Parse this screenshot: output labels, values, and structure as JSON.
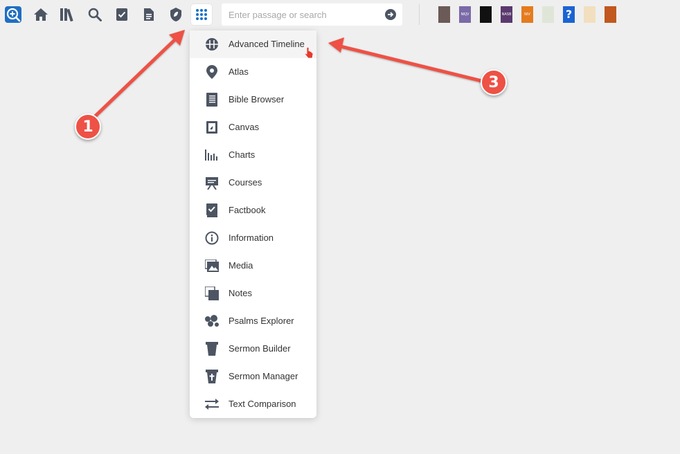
{
  "toolbar": {
    "icons": [
      "logos-app-icon",
      "home-icon",
      "library-icon",
      "search-icon",
      "documents-checklist-icon",
      "document-icon",
      "shield-leaf-icon",
      "apps-grid-icon"
    ],
    "search_placeholder": "Enter passage or search",
    "search_value": "",
    "book_covers": [
      {
        "color": "#6b5a57",
        "label": ""
      },
      {
        "color": "#7a6aa8",
        "label": "NKJV"
      },
      {
        "color": "#111111",
        "label": ""
      },
      {
        "color": "#5a3a6e",
        "label": "NASB"
      },
      {
        "color": "#e57b1f",
        "label": "NIV"
      },
      {
        "color": "#dfe6d8",
        "label": ""
      },
      {
        "color": "#1a64d2",
        "label": "?"
      },
      {
        "color": "#f2dfc0",
        "label": ""
      },
      {
        "color": "#c1581e",
        "label": ""
      }
    ]
  },
  "menu": {
    "hovered_index": 0,
    "items": [
      {
        "label": "Advanced Timeline",
        "icon": "timeline-icon"
      },
      {
        "label": "Atlas",
        "icon": "map-pin-icon"
      },
      {
        "label": "Bible Browser",
        "icon": "bible-browser-icon"
      },
      {
        "label": "Canvas",
        "icon": "canvas-icon"
      },
      {
        "label": "Charts",
        "icon": "charts-icon"
      },
      {
        "label": "Courses",
        "icon": "courses-icon"
      },
      {
        "label": "Factbook",
        "icon": "factbook-icon"
      },
      {
        "label": "Information",
        "icon": "info-icon"
      },
      {
        "label": "Media",
        "icon": "media-icon"
      },
      {
        "label": "Notes",
        "icon": "notes-icon"
      },
      {
        "label": "Psalms Explorer",
        "icon": "psalms-explorer-icon"
      },
      {
        "label": "Sermon Builder",
        "icon": "sermon-builder-icon"
      },
      {
        "label": "Sermon Manager",
        "icon": "sermon-manager-icon"
      },
      {
        "label": "Text Comparison",
        "icon": "text-comparison-icon"
      }
    ]
  },
  "annotations": {
    "badge1": "1",
    "badge3": "3"
  },
  "colors": {
    "icon": "#4d5563",
    "accent": "#1670c8",
    "annotation": "#ee5145"
  }
}
